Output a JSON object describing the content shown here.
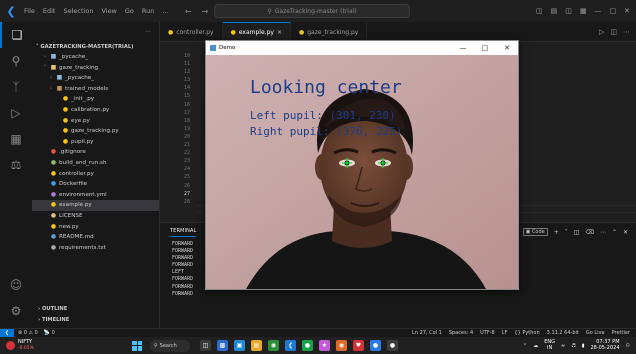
{
  "titlebar": {
    "menu": [
      "File",
      "Edit",
      "Selection",
      "View",
      "Go",
      "Run",
      "…"
    ],
    "search_text": "GazeTracking-master (trial)"
  },
  "sidebar": {
    "root": "GAZETRACKING-MASTER(TRIAL)",
    "items": [
      {
        "label": "_pycache_",
        "indent": 1,
        "chevron": ">",
        "icon": "folder-icon",
        "iconColor": "#8fb9e0",
        "selected": false
      },
      {
        "label": "gaze_tracking",
        "indent": 1,
        "chevron": "v",
        "icon": "folder-open-icon",
        "iconColor": "#e8c26a",
        "selected": false
      },
      {
        "label": "_pycache_",
        "indent": 2,
        "chevron": ">",
        "icon": "folder-icon",
        "iconColor": "#8fb9e0",
        "selected": false
      },
      {
        "label": "trained_models",
        "indent": 2,
        "chevron": ">",
        "icon": "folder-icon",
        "iconColor": "#c09553",
        "selected": false
      },
      {
        "label": "_init_.py",
        "indent": 3,
        "chevron": "",
        "icon": "python-file-icon",
        "iconColor": "#f5c518",
        "selected": false
      },
      {
        "label": "calibration.py",
        "indent": 3,
        "chevron": "",
        "icon": "python-file-icon",
        "iconColor": "#f5c518",
        "selected": false
      },
      {
        "label": "eye.py",
        "indent": 3,
        "chevron": "",
        "icon": "python-file-icon",
        "iconColor": "#f5c518",
        "selected": false
      },
      {
        "label": "gaze_tracking.py",
        "indent": 3,
        "chevron": "",
        "icon": "python-file-icon",
        "iconColor": "#f5c518",
        "selected": false
      },
      {
        "label": "pupil.py",
        "indent": 3,
        "chevron": "",
        "icon": "python-file-icon",
        "iconColor": "#f5c518",
        "selected": false
      },
      {
        "label": ".gitignore",
        "indent": 1,
        "chevron": "",
        "icon": "git-icon",
        "iconColor": "#e5533d",
        "selected": false
      },
      {
        "label": "build_and_run.sh",
        "indent": 1,
        "chevron": "",
        "icon": "shell-file-icon",
        "iconColor": "#8fbf6f",
        "selected": false
      },
      {
        "label": "controller.py",
        "indent": 1,
        "chevron": "",
        "icon": "python-file-icon",
        "iconColor": "#f5c518",
        "selected": false
      },
      {
        "label": "Dockerfile",
        "indent": 1,
        "chevron": "",
        "icon": "docker-icon",
        "iconColor": "#3aa0e6",
        "selected": false
      },
      {
        "label": "environment.yml",
        "indent": 1,
        "chevron": "",
        "icon": "yaml-file-icon",
        "iconColor": "#b07ad8",
        "selected": false
      },
      {
        "label": "example.py",
        "indent": 1,
        "chevron": "",
        "icon": "python-file-icon",
        "iconColor": "#f5c518",
        "selected": true
      },
      {
        "label": "LICENSE",
        "indent": 1,
        "chevron": "",
        "icon": "license-icon",
        "iconColor": "#e5c07b",
        "selected": false
      },
      {
        "label": "new.py",
        "indent": 1,
        "chevron": "",
        "icon": "python-file-icon",
        "iconColor": "#f5c518",
        "selected": false
      },
      {
        "label": "README.md",
        "indent": 1,
        "chevron": "",
        "icon": "markdown-icon",
        "iconColor": "#5aa0e0",
        "selected": false
      },
      {
        "label": "requirements.txt",
        "indent": 1,
        "chevron": "",
        "icon": "text-file-icon",
        "iconColor": "#aaaaaa",
        "selected": false
      }
    ],
    "outline": "OUTLINE",
    "timeline": "TIMELINE"
  },
  "tabs": [
    {
      "label": "controller.py",
      "active": false,
      "close": ""
    },
    {
      "label": "example.py",
      "active": true,
      "close": "×"
    },
    {
      "label": "gaze_tracking.py",
      "active": false,
      "close": ""
    }
  ],
  "editor": {
    "line_numbers": [
      "10",
      "11",
      "12",
      "13",
      "14",
      "15",
      "16",
      "17",
      "18",
      "19",
      "20",
      "21",
      "22",
      "23",
      "24",
      "25",
      "26",
      "27",
      "28"
    ],
    "current_line": "27"
  },
  "panel": {
    "title": "TERMINAL",
    "code_label": "Code",
    "lines": [
      "FORWARD",
      "FORWARD",
      "FORWARD",
      "FORWARD",
      "LEFT",
      "FORWARD",
      "FORWARD",
      "FORWARD"
    ]
  },
  "statusbar": {
    "left": [
      "⊗ 0 ⚠ 0",
      "📡 0"
    ],
    "right": [
      "Ln 27, Col 1",
      "Spaces: 4",
      "UTF-8",
      "LF",
      "{} Python",
      "3.11.2 64-bit",
      "Go Live",
      "Prettier"
    ]
  },
  "camera_window": {
    "title": "Demo",
    "headline": "Looking center",
    "left_pupil": "Left pupil: (301, 230)",
    "right_pupil": "Right pupil: (376, 225)"
  },
  "taskbar": {
    "stock_name": "NIFTY",
    "stock_change": "-0.05%",
    "search_label": "Search",
    "lang_top": "ENG",
    "lang_bottom": "IN",
    "time": "07:37 PM",
    "date": "28-05-2024"
  },
  "colors": {
    "accent": "#0078d4",
    "overlay_text": "#1d3d88",
    "pupil_mark": "#18e040"
  }
}
